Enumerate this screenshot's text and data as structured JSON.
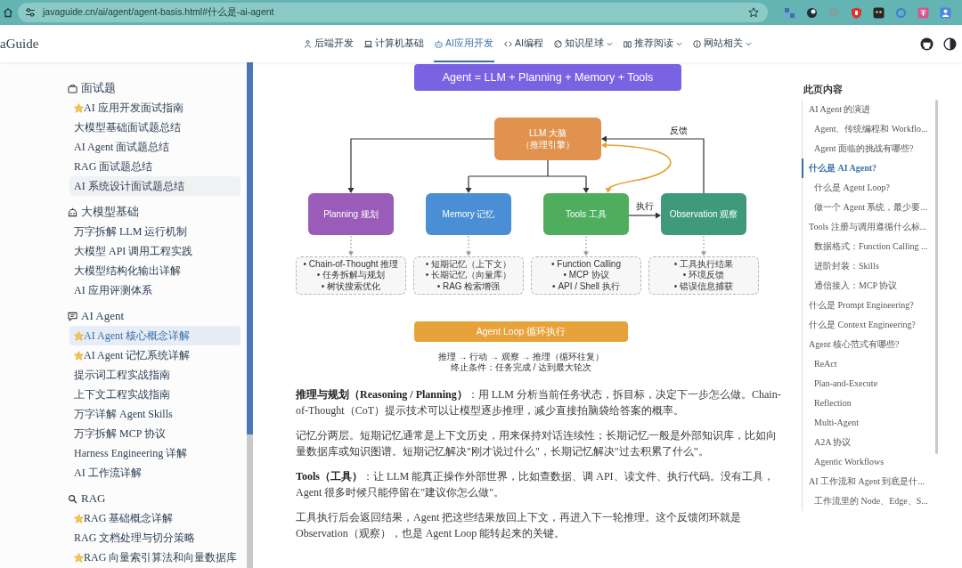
{
  "browser": {
    "url": "javaguide.cn/ai/agent/agent-basis.html#什么是-ai-agent"
  },
  "site": {
    "logo": "aGuide",
    "nav": [
      {
        "label": "后端开发",
        "selected": false,
        "dropdown": false
      },
      {
        "label": "计算机基础",
        "selected": false,
        "dropdown": false
      },
      {
        "label": "AI应用开发",
        "selected": true,
        "dropdown": false
      },
      {
        "label": "AI编程",
        "selected": false,
        "dropdown": false
      },
      {
        "label": "知识星球",
        "selected": false,
        "dropdown": true
      },
      {
        "label": "推荐阅读",
        "selected": false,
        "dropdown": true
      },
      {
        "label": "网站相关",
        "selected": false,
        "dropdown": true
      }
    ]
  },
  "sidebar": {
    "groups": [
      {
        "title": "面试题",
        "items": [
          {
            "label": "AI 应用开发面试指南",
            "starred": true,
            "selected": false,
            "hovered": false
          },
          {
            "label": "大模型基础面试题总结",
            "starred": false,
            "selected": false,
            "hovered": false
          },
          {
            "label": "AI Agent 面试题总结",
            "starred": false,
            "selected": false,
            "hovered": false
          },
          {
            "label": "RAG 面试题总结",
            "starred": false,
            "selected": false,
            "hovered": false
          },
          {
            "label": "AI 系统设计面试题总结",
            "starred": false,
            "selected": false,
            "hovered": true
          }
        ]
      },
      {
        "title": "大模型基础",
        "items": [
          {
            "label": "万字拆解 LLM 运行机制",
            "starred": false,
            "selected": false,
            "hovered": false
          },
          {
            "label": "大模型 API 调用工程实践",
            "starred": false,
            "selected": false,
            "hovered": false
          },
          {
            "label": "大模型结构化输出详解",
            "starred": false,
            "selected": false,
            "hovered": false
          },
          {
            "label": "AI 应用评测体系",
            "starred": false,
            "selected": false,
            "hovered": false
          }
        ]
      },
      {
        "title": "AI Agent",
        "items": [
          {
            "label": "AI Agent 核心概念详解",
            "starred": true,
            "selected": true,
            "hovered": false
          },
          {
            "label": "AI Agent 记忆系统详解",
            "starred": true,
            "selected": false,
            "hovered": false
          },
          {
            "label": "提示词工程实战指南",
            "starred": false,
            "selected": false,
            "hovered": false
          },
          {
            "label": "上下文工程实战指南",
            "starred": false,
            "selected": false,
            "hovered": false
          },
          {
            "label": "万字详解 Agent Skills",
            "starred": false,
            "selected": false,
            "hovered": false
          },
          {
            "label": "万字拆解 MCP 协议",
            "starred": false,
            "selected": false,
            "hovered": false
          },
          {
            "label": "Harness Engineering 详解",
            "starred": false,
            "selected": false,
            "hovered": false
          },
          {
            "label": "AI 工作流详解",
            "starred": false,
            "selected": false,
            "hovered": false
          }
        ]
      },
      {
        "title": "RAG",
        "items": [
          {
            "label": "RAG 基础概念详解",
            "starred": true,
            "selected": false,
            "hovered": false
          },
          {
            "label": "RAG 文档处理与切分策略",
            "starred": false,
            "selected": false,
            "hovered": false
          },
          {
            "label": "RAG 向量索引算法和向量数据库",
            "starred": true,
            "selected": false,
            "hovered": false
          }
        ]
      }
    ]
  },
  "article": {
    "diagram": {
      "header": "Agent = LLM + Planning + Memory + Tools",
      "core": [
        "LLM 大脑",
        "（推理引擎）"
      ],
      "modules": [
        {
          "label": "Planning 规划",
          "color": "#9a5cb8",
          "details": [
            "• Chain-of-Thought 推理",
            "• 任务拆解与规划",
            "• 树状搜索优化"
          ]
        },
        {
          "label": "Memory 记忆",
          "color": "#4a8fd6",
          "details": [
            "• 短期记忆（上下文）",
            "• 长期记忆（向量库）",
            "• RAG 检索增强"
          ]
        },
        {
          "label": "Tools 工具",
          "color": "#4fae5e",
          "details": [
            "• Function Calling",
            "• MCP 协议",
            "• API / Shell 执行"
          ]
        },
        {
          "label": "Observation 观察",
          "color": "#3f9a7c",
          "details": [
            "• 工具执行结果",
            "• 环境反馈",
            "• 错误信息捕获"
          ]
        }
      ],
      "execute_label": "执行",
      "feedback_label": "反馈",
      "loop": "Agent Loop 循环执行",
      "caption": [
        "推理 → 行动 → 观察 → 推理（循环往复）",
        "终止条件：任务完成 / 达到最大轮次"
      ]
    },
    "paragraphs": [
      "**推理与规划（Reasoning / Planning）**：用 LLM 分析当前任务状态，拆目标，决定下一步怎么做。Chain-of-Thought（CoT）提示技术可以让模型逐步推理，减少直接拍脑袋给答案的概率。",
      "记忆分两层。短期记忆通常是上下文历史，用来保持对话连续性；长期记忆一般是外部知识库，比如向量数据库或知识图谱。短期记忆解决\"刚才说过什么\"，长期记忆解决\"过去积累了什么\"。",
      "**Tools（工具）**：让 LLM 能真正操作外部世界，比如查数据、调 API、读文件、执行代码。没有工具，Agent 很多时候只能停留在\"建议你怎么做\"。",
      "工具执行后会返回结果，Agent 把这些结果放回上下文，再进入下一轮推理。这个反馈闭环就是 Observation（观察），也是 Agent Loop 能转起来的关键。"
    ]
  },
  "toc": {
    "title": "此页内容",
    "items": [
      {
        "label": "AI Agent 的演进",
        "selected": false,
        "children": [
          {
            "label": "Agent、传统编程和 Workflo...",
            "selected": false
          },
          {
            "label": "Agent 面临的挑战有哪些?",
            "selected": false
          }
        ]
      },
      {
        "label": "什么是 AI Agent?",
        "selected": true,
        "children": [
          {
            "label": "什么是 Agent Loop?",
            "selected": false
          },
          {
            "label": "做一个 Agent 系统，最少要...",
            "selected": false
          }
        ]
      },
      {
        "label": "Tools 注册与调用遵循什么标...",
        "selected": false,
        "children": [
          {
            "label": "数据格式：Function Calling ...",
            "selected": false
          },
          {
            "label": "进阶封装：Skills",
            "selected": false
          },
          {
            "label": "通信接入：MCP 协议",
            "selected": false
          }
        ]
      },
      {
        "label": "什么是 Prompt Engineering?",
        "selected": false
      },
      {
        "label": "什么是 Context Engineering?",
        "selected": false
      },
      {
        "label": "Agent 核心范式有哪些?",
        "selected": false,
        "children": [
          {
            "label": "ReAct",
            "selected": false
          },
          {
            "label": "Plan-and-Execute",
            "selected": false
          },
          {
            "label": "Reflection",
            "selected": false
          },
          {
            "label": "Multi-Agent",
            "selected": false
          },
          {
            "label": "A2A 协议",
            "selected": false
          },
          {
            "label": "Agentic Workflows",
            "selected": false
          }
        ]
      },
      {
        "label": "AI 工作流和 Agent 到底是什...",
        "selected": false,
        "children": [
          {
            "label": "工作流里的 Node、Edge、S...",
            "selected": false
          }
        ]
      }
    ]
  }
}
